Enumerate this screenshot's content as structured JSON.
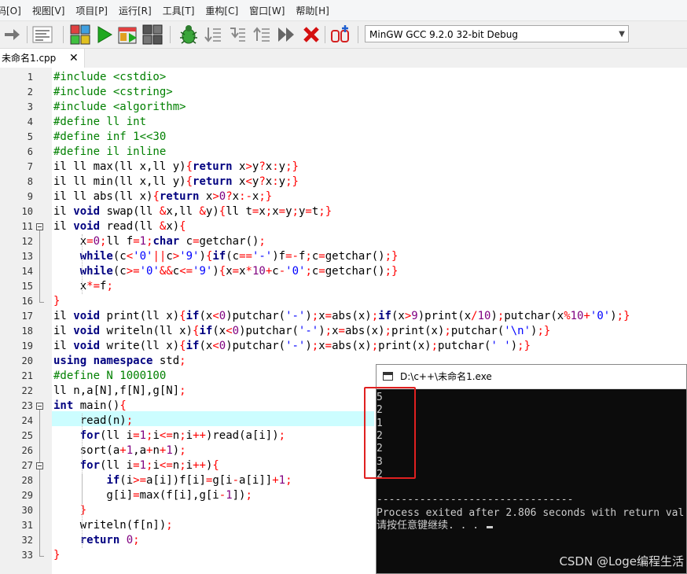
{
  "menu": [
    "码[O]",
    "视图[V]",
    "项目[P]",
    "运行[R]",
    "工具[T]",
    "重构[C]",
    "窗口[W]",
    "帮助[H]"
  ],
  "toolbar": {
    "icons": [
      "arrow-right-icon",
      "syntax-check-icon",
      "compile-icon",
      "run-icon",
      "compile-run-icon",
      "rebuild-icon",
      "debug-bug-icon",
      "step-over-icon",
      "step-into-icon",
      "step-out-icon",
      "continue-icon",
      "stop-icon",
      "profile-icon"
    ],
    "compiler": "MinGW GCC 9.2.0 32-bit Debug"
  },
  "tab": {
    "filename": "未命名1.cpp",
    "close": "✕"
  },
  "editor": {
    "line_numbers": [
      "1",
      "2",
      "3",
      "4",
      "5",
      "6",
      "7",
      "8",
      "9",
      "10",
      "11",
      "12",
      "13",
      "14",
      "15",
      "16",
      "17",
      "18",
      "19",
      "20",
      "21",
      "22",
      "23",
      "24",
      "25",
      "26",
      "27",
      "28",
      "29",
      "30",
      "31",
      "32",
      "33"
    ],
    "lines": [
      [
        [
          "pp",
          "#include <cstdio>"
        ]
      ],
      [
        [
          "pp",
          "#include <cstring>"
        ]
      ],
      [
        [
          "pp",
          "#include <algorithm>"
        ]
      ],
      [
        [
          "pp",
          "#define ll int"
        ]
      ],
      [
        [
          "pp",
          "#define inf 1<<30"
        ]
      ],
      [
        [
          "pp",
          "#define il inline"
        ]
      ],
      [
        [
          "plain",
          "il ll max(ll x,ll y)"
        ],
        [
          "op",
          "{"
        ],
        [
          "kw",
          "return"
        ],
        [
          "plain",
          " x"
        ],
        [
          "op",
          ">"
        ],
        [
          "plain",
          "y"
        ],
        [
          "op",
          "?"
        ],
        [
          "plain",
          "x"
        ],
        [
          "op",
          ":"
        ],
        [
          "plain",
          "y"
        ],
        [
          "op",
          ";}"
        ]
      ],
      [
        [
          "plain",
          "il ll min(ll x,ll y)"
        ],
        [
          "op",
          "{"
        ],
        [
          "kw",
          "return"
        ],
        [
          "plain",
          " x"
        ],
        [
          "op",
          "<"
        ],
        [
          "plain",
          "y"
        ],
        [
          "op",
          "?"
        ],
        [
          "plain",
          "x"
        ],
        [
          "op",
          ":"
        ],
        [
          "plain",
          "y"
        ],
        [
          "op",
          ";}"
        ]
      ],
      [
        [
          "plain",
          "il ll abs(ll x)"
        ],
        [
          "op",
          "{"
        ],
        [
          "kw",
          "return"
        ],
        [
          "plain",
          " x"
        ],
        [
          "op",
          ">"
        ],
        [
          "num",
          "0"
        ],
        [
          "op",
          "?"
        ],
        [
          "plain",
          "x"
        ],
        [
          "op",
          ":-"
        ],
        [
          "plain",
          "x"
        ],
        [
          "op",
          ";}"
        ]
      ],
      [
        [
          "plain",
          "il "
        ],
        [
          "kw",
          "void"
        ],
        [
          "plain",
          " swap(ll "
        ],
        [
          "op",
          "&"
        ],
        [
          "plain",
          "x,ll "
        ],
        [
          "op",
          "&"
        ],
        [
          "plain",
          "y)"
        ],
        [
          "op",
          "{"
        ],
        [
          "plain",
          "ll t"
        ],
        [
          "op",
          "="
        ],
        [
          "plain",
          "x"
        ],
        [
          "op",
          ";"
        ],
        [
          "plain",
          "x"
        ],
        [
          "op",
          "="
        ],
        [
          "plain",
          "y"
        ],
        [
          "op",
          ";"
        ],
        [
          "plain",
          "y"
        ],
        [
          "op",
          "="
        ],
        [
          "plain",
          "t"
        ],
        [
          "op",
          ";}"
        ]
      ],
      [
        [
          "plain",
          "il "
        ],
        [
          "kw",
          "void"
        ],
        [
          "plain",
          " read(ll "
        ],
        [
          "op",
          "&"
        ],
        [
          "plain",
          "x)"
        ],
        [
          "op",
          "{"
        ]
      ],
      [
        [
          "plain",
          "    x"
        ],
        [
          "op",
          "="
        ],
        [
          "num",
          "0"
        ],
        [
          "op",
          ";"
        ],
        [
          "plain",
          "ll f"
        ],
        [
          "op",
          "="
        ],
        [
          "num",
          "1"
        ],
        [
          "op",
          ";"
        ],
        [
          "kw",
          "char"
        ],
        [
          "plain",
          " c"
        ],
        [
          "op",
          "="
        ],
        [
          "plain",
          "getchar()"
        ],
        [
          "op",
          ";"
        ]
      ],
      [
        [
          "plain",
          "    "
        ],
        [
          "kw",
          "while"
        ],
        [
          "plain",
          "(c"
        ],
        [
          "op",
          "<"
        ],
        [
          "str",
          "'0'"
        ],
        [
          "op",
          "||"
        ],
        [
          "plain",
          "c"
        ],
        [
          "op",
          ">"
        ],
        [
          "str",
          "'9'"
        ],
        [
          "plain",
          ")"
        ],
        [
          "op",
          "{"
        ],
        [
          "kw",
          "if"
        ],
        [
          "plain",
          "(c"
        ],
        [
          "op",
          "=="
        ],
        [
          "str",
          "'-'"
        ],
        [
          "plain",
          ")f"
        ],
        [
          "op",
          "=-"
        ],
        [
          "plain",
          "f"
        ],
        [
          "op",
          ";"
        ],
        [
          "plain",
          "c"
        ],
        [
          "op",
          "="
        ],
        [
          "plain",
          "getchar()"
        ],
        [
          "op",
          ";}"
        ]
      ],
      [
        [
          "plain",
          "    "
        ],
        [
          "kw",
          "while"
        ],
        [
          "plain",
          "(c"
        ],
        [
          "op",
          ">="
        ],
        [
          "str",
          "'0'"
        ],
        [
          "op",
          "&&"
        ],
        [
          "plain",
          "c"
        ],
        [
          "op",
          "<="
        ],
        [
          "str",
          "'9'"
        ],
        [
          "plain",
          ")"
        ],
        [
          "op",
          "{"
        ],
        [
          "plain",
          "x"
        ],
        [
          "op",
          "="
        ],
        [
          "plain",
          "x"
        ],
        [
          "op",
          "*"
        ],
        [
          "num",
          "10"
        ],
        [
          "op",
          "+"
        ],
        [
          "plain",
          "c"
        ],
        [
          "op",
          "-"
        ],
        [
          "str",
          "'0'"
        ],
        [
          "op",
          ";"
        ],
        [
          "plain",
          "c"
        ],
        [
          "op",
          "="
        ],
        [
          "plain",
          "getchar()"
        ],
        [
          "op",
          ";}"
        ]
      ],
      [
        [
          "plain",
          "    x"
        ],
        [
          "op",
          "*="
        ],
        [
          "plain",
          "f"
        ],
        [
          "op",
          ";"
        ]
      ],
      [
        [
          "op",
          "}"
        ]
      ],
      [
        [
          "plain",
          "il "
        ],
        [
          "kw",
          "void"
        ],
        [
          "plain",
          " print(ll x)"
        ],
        [
          "op",
          "{"
        ],
        [
          "kw",
          "if"
        ],
        [
          "plain",
          "(x"
        ],
        [
          "op",
          "<"
        ],
        [
          "num",
          "0"
        ],
        [
          "plain",
          ")putchar("
        ],
        [
          "str",
          "'-'"
        ],
        [
          "plain",
          ")"
        ],
        [
          "op",
          ";"
        ],
        [
          "plain",
          "x"
        ],
        [
          "op",
          "="
        ],
        [
          "plain",
          "abs(x)"
        ],
        [
          "op",
          ";"
        ],
        [
          "kw",
          "if"
        ],
        [
          "plain",
          "(x"
        ],
        [
          "op",
          ">"
        ],
        [
          "num",
          "9"
        ],
        [
          "plain",
          ")print(x"
        ],
        [
          "op",
          "/"
        ],
        [
          "num",
          "10"
        ],
        [
          "plain",
          ")"
        ],
        [
          "op",
          ";"
        ],
        [
          "plain",
          "putchar(x"
        ],
        [
          "op",
          "%"
        ],
        [
          "num",
          "10"
        ],
        [
          "op",
          "+"
        ],
        [
          "str",
          "'0'"
        ],
        [
          "plain",
          ")"
        ],
        [
          "op",
          ";}"
        ]
      ],
      [
        [
          "plain",
          "il "
        ],
        [
          "kw",
          "void"
        ],
        [
          "plain",
          " writeln(ll x)"
        ],
        [
          "op",
          "{"
        ],
        [
          "kw",
          "if"
        ],
        [
          "plain",
          "(x"
        ],
        [
          "op",
          "<"
        ],
        [
          "num",
          "0"
        ],
        [
          "plain",
          ")putchar("
        ],
        [
          "str",
          "'-'"
        ],
        [
          "plain",
          ")"
        ],
        [
          "op",
          ";"
        ],
        [
          "plain",
          "x"
        ],
        [
          "op",
          "="
        ],
        [
          "plain",
          "abs(x)"
        ],
        [
          "op",
          ";"
        ],
        [
          "plain",
          "print(x)"
        ],
        [
          "op",
          ";"
        ],
        [
          "plain",
          "putchar("
        ],
        [
          "str",
          "'\\n'"
        ],
        [
          "plain",
          ")"
        ],
        [
          "op",
          ";}"
        ]
      ],
      [
        [
          "plain",
          "il "
        ],
        [
          "kw",
          "void"
        ],
        [
          "plain",
          " write(ll x)"
        ],
        [
          "op",
          "{"
        ],
        [
          "kw",
          "if"
        ],
        [
          "plain",
          "(x"
        ],
        [
          "op",
          "<"
        ],
        [
          "num",
          "0"
        ],
        [
          "plain",
          ")putchar("
        ],
        [
          "str",
          "'-'"
        ],
        [
          "plain",
          ")"
        ],
        [
          "op",
          ";"
        ],
        [
          "plain",
          "x"
        ],
        [
          "op",
          "="
        ],
        [
          "plain",
          "abs(x)"
        ],
        [
          "op",
          ";"
        ],
        [
          "plain",
          "print(x)"
        ],
        [
          "op",
          ";"
        ],
        [
          "plain",
          "putchar("
        ],
        [
          "str",
          "' '"
        ],
        [
          "plain",
          ")"
        ],
        [
          "op",
          ";}"
        ]
      ],
      [
        [
          "kw",
          "using namespace"
        ],
        [
          "plain",
          " std"
        ],
        [
          "op",
          ";"
        ]
      ],
      [
        [
          "pp",
          "#define N 1000100"
        ]
      ],
      [
        [
          "plain",
          "ll n,a[N],f[N],g[N]"
        ],
        [
          "op",
          ";"
        ]
      ],
      [
        [
          "kw",
          "int"
        ],
        [
          "plain",
          " main()"
        ],
        [
          "op",
          "{"
        ]
      ],
      [
        [
          "plain",
          "    read(n)"
        ],
        [
          "op",
          ";"
        ]
      ],
      [
        [
          "plain",
          "    "
        ],
        [
          "kw",
          "for"
        ],
        [
          "plain",
          "(ll i"
        ],
        [
          "op",
          "="
        ],
        [
          "num",
          "1"
        ],
        [
          "op",
          ";"
        ],
        [
          "plain",
          "i"
        ],
        [
          "op",
          "<="
        ],
        [
          "plain",
          "n"
        ],
        [
          "op",
          ";"
        ],
        [
          "plain",
          "i"
        ],
        [
          "op",
          "++"
        ],
        [
          "plain",
          ")read(a[i])"
        ],
        [
          "op",
          ";"
        ]
      ],
      [
        [
          "plain",
          "    sort(a"
        ],
        [
          "op",
          "+"
        ],
        [
          "num",
          "1"
        ],
        [
          "plain",
          ",a"
        ],
        [
          "op",
          "+"
        ],
        [
          "plain",
          "n"
        ],
        [
          "op",
          "+"
        ],
        [
          "num",
          "1"
        ],
        [
          "plain",
          ")"
        ],
        [
          "op",
          ";"
        ]
      ],
      [
        [
          "plain",
          "    "
        ],
        [
          "kw",
          "for"
        ],
        [
          "plain",
          "(ll i"
        ],
        [
          "op",
          "="
        ],
        [
          "num",
          "1"
        ],
        [
          "op",
          ";"
        ],
        [
          "plain",
          "i"
        ],
        [
          "op",
          "<="
        ],
        [
          "plain",
          "n"
        ],
        [
          "op",
          ";"
        ],
        [
          "plain",
          "i"
        ],
        [
          "op",
          "++"
        ],
        [
          "plain",
          ")"
        ],
        [
          "op",
          "{"
        ]
      ],
      [
        [
          "plain",
          "        "
        ],
        [
          "kw",
          "if"
        ],
        [
          "plain",
          "(i"
        ],
        [
          "op",
          ">="
        ],
        [
          "plain",
          "a[i])f[i]"
        ],
        [
          "op",
          "="
        ],
        [
          "plain",
          "g[i"
        ],
        [
          "op",
          "-"
        ],
        [
          "plain",
          "a[i]]"
        ],
        [
          "op",
          "+"
        ],
        [
          "num",
          "1"
        ],
        [
          "op",
          ";"
        ]
      ],
      [
        [
          "plain",
          "        g[i]"
        ],
        [
          "op",
          "="
        ],
        [
          "plain",
          "max(f[i],g[i"
        ],
        [
          "op",
          "-"
        ],
        [
          "num",
          "1"
        ],
        [
          "plain",
          "])"
        ],
        [
          "op",
          ";"
        ]
      ],
      [
        [
          "plain",
          "    "
        ],
        [
          "op",
          "}"
        ]
      ],
      [
        [
          "plain",
          "    writeln(f[n])"
        ],
        [
          "op",
          ";"
        ]
      ],
      [
        [
          "plain",
          "    "
        ],
        [
          "kw",
          "return"
        ],
        [
          "plain",
          " "
        ],
        [
          "num",
          "0"
        ],
        [
          "op",
          ";"
        ]
      ],
      [
        [
          "op",
          "}"
        ]
      ]
    ]
  },
  "console": {
    "title": "D:\\c++\\未命名1.exe",
    "output": [
      "5",
      "2",
      "1",
      "2",
      "2",
      "3",
      "2"
    ],
    "separator": "--------------------------------",
    "exit_msg": "Process exited after 2.806 seconds with return val",
    "prompt": "请按任意键继续. . . "
  },
  "watermark": "CSDN @Loge编程生活"
}
